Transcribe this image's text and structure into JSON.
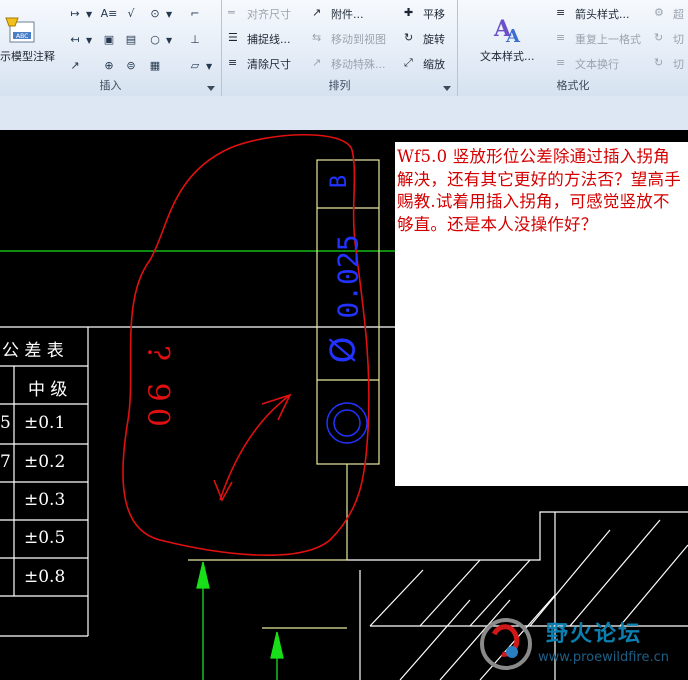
{
  "ribbon": {
    "groups": {
      "insert": {
        "label": "插入"
      },
      "arrange": {
        "label": "排列"
      },
      "format": {
        "label": "格式化"
      }
    },
    "show_model_annotation": "示模型注释",
    "arrange_buttons": {
      "align_dimension": "对齐尺寸",
      "attachment": "附件...",
      "pan": "平移",
      "snap_line": "捕捉线...",
      "move_to_view": "移动到视图",
      "rotate": "旋转",
      "clean_dimension": "清除尺寸",
      "move_special": "移动特殊...",
      "scale": "缩放"
    },
    "format_buttons": {
      "text_style": "文本样式...",
      "arrow_style": "箭头样式...",
      "repeat_last_format": "重复上一格式",
      "text_wrap": "文本换行",
      "partial_1": "超",
      "partial_2": "切",
      "partial_3": "切"
    }
  },
  "drawing": {
    "tolerance_table": {
      "title": "公 差 表",
      "column_header": "中 级",
      "values": [
        "±0.1",
        "±0.2",
        "±0.3",
        "±0.5",
        "±0.8"
      ],
      "left_fragments": [
        "5",
        "7"
      ]
    },
    "gtol_frame": {
      "datum": "B",
      "value": "0.025",
      "symbol": "Ø",
      "characteristic": "concentricity"
    },
    "note": {
      "text": "Wf5.0 竖放形位公差除通过插入拐角解决，还有其它更好的方法否？望高手赐教.试着用插入拐角，可感觉竖放不够直。还是本人没操作好？"
    },
    "sketch_annotation": "? 90"
  },
  "watermark": {
    "title": "野火论坛",
    "url": "www.proewildfire.cn"
  },
  "colors": {
    "background": "#000000",
    "note_text": "#d40000",
    "sketch_red": "#e01010",
    "gtol_blue": "#2233ff",
    "gtol_frame": "#e8e8a0",
    "green_line": "#18e018",
    "ribbon_bg": "#e4ecf6"
  }
}
